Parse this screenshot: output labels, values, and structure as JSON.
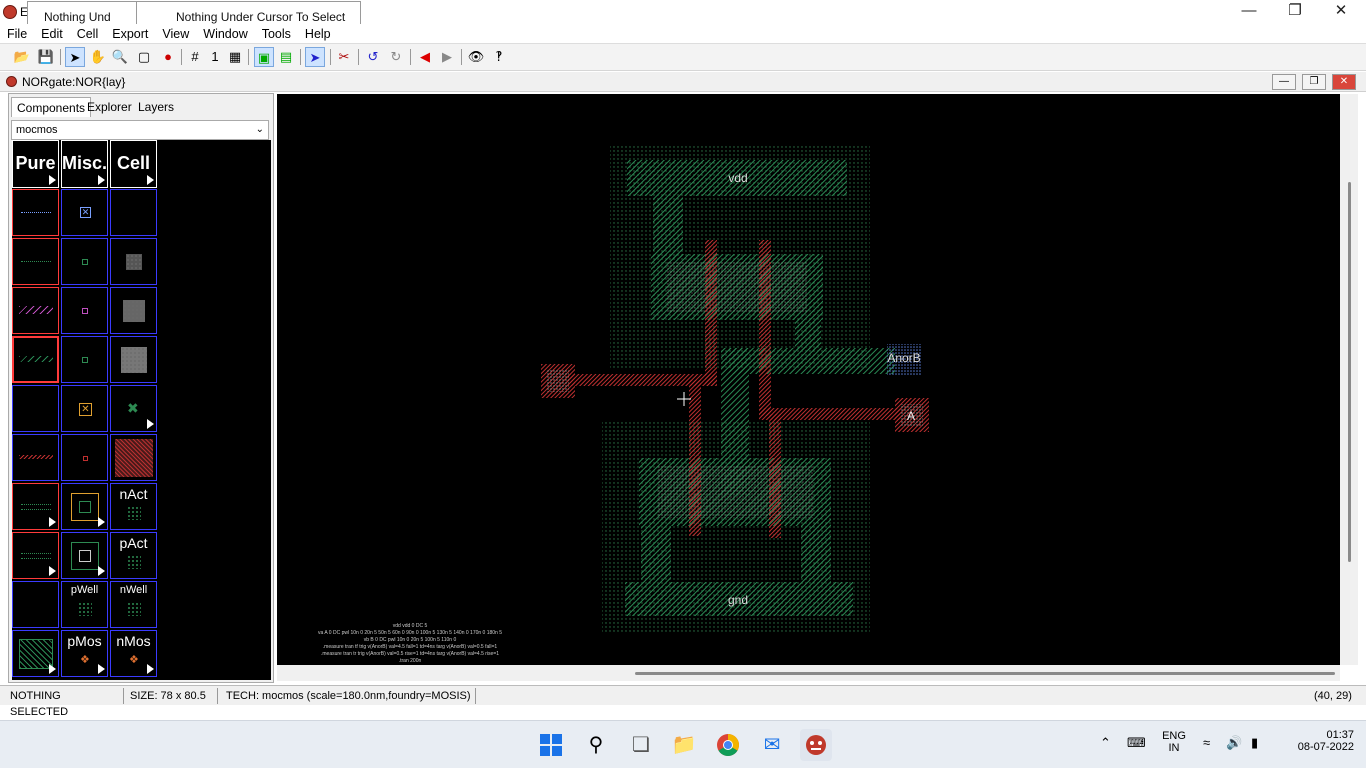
{
  "titlebar": {
    "app_letter": "E",
    "tooltip_back": "Nothing Und",
    "tooltip_front": "Nothing Under Cursor To Select",
    "minimize": "—",
    "maximize": "❐",
    "close": "✕"
  },
  "menu": [
    "File",
    "Edit",
    "Cell",
    "Export",
    "View",
    "Window",
    "Tools",
    "Help"
  ],
  "toolbar": {
    "grid_value": "1"
  },
  "document": {
    "title": "NORgate:NOR{lay}"
  },
  "left_panel": {
    "tabs": [
      "Components",
      "Explorer",
      "Layers"
    ],
    "technology": "mocmos",
    "palette_headers": [
      "Pure",
      "Misc.",
      "Cell"
    ],
    "palette_labels": {
      "nact": "nAct",
      "pact": "pAct",
      "pwell": "pWell",
      "nwell": "nWell",
      "pmos": "pMos",
      "nmos": "nMos"
    }
  },
  "layout_labels": {
    "vdd": "vdd",
    "gnd": "gnd",
    "output": "AnorB",
    "input_a": "A"
  },
  "spice_text": [
    "vdd vdd 0 DC 5",
    "va A 0 DC pwl 10n 0 20n 5 50n 5 60n 0 90n 0 100n 5 130n 5 140n 0 170n 0 180n 5",
    "vb B 0 DC pwl 10n 0 20n 5 100n 5 110n 0",
    ".measure tran tf trig v(AnorB) val=4.5 fall=1 td=4ns targ v(AnorB) val=0.5 fall=1",
    ".measure tran tr trig v(AnorB) val=0.5 rise=1 td=4ns targ v(AnorB) val=4.5 rise=1",
    ".tran 200n"
  ],
  "status": {
    "selection": "NOTHING SELECTED",
    "size": "SIZE: 78 x 80.5",
    "tech": "TECH: mocmos (scale=180.0nm,foundry=MOSIS)",
    "coords": "(40, 29)"
  },
  "taskbar": {
    "lang": "ENG",
    "region": "IN",
    "time": "01:37",
    "date": "08-07-2022"
  },
  "colors": {
    "canvas": "#000000",
    "active": "#2a8a55",
    "poly": "#b83030",
    "metal": "#5577cc"
  }
}
